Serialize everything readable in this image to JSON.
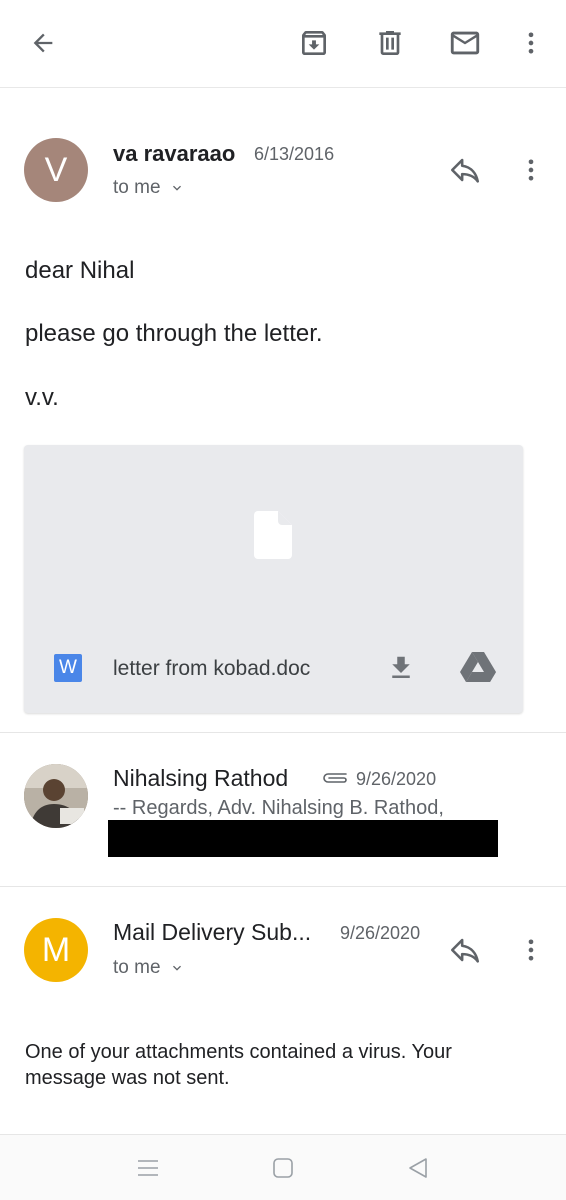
{
  "toolbar": {
    "back_icon": "arrow-back-icon",
    "archive_icon": "archive-icon",
    "delete_icon": "trash-icon",
    "mark_unread_icon": "mail-icon",
    "more_icon": "more-vert-icon"
  },
  "messages": [
    {
      "avatar_letter": "V",
      "avatar_color": "#a5867a",
      "sender": "va ravaraao",
      "date": "6/13/2016",
      "recipient": "to me",
      "body": [
        "dear Nihal",
        "please go through the letter.",
        "v.v."
      ],
      "attachment": {
        "badge": "W",
        "filename": "letter from kobad.doc",
        "file_icon": "file-icon",
        "download_icon": "download-icon",
        "drive_icon": "google-drive-icon"
      }
    },
    {
      "sender": "Nihalsing Rathod",
      "date": "9/26/2020",
      "attachment_icon": "paperclip-icon",
      "snippet": "-- Regards, Adv. Nihalsing B. Rathod,"
    },
    {
      "avatar_letter": "M",
      "avatar_color": "#f4b400",
      "sender": "Mail Delivery Sub...",
      "date": "9/26/2020",
      "recipient": "to me",
      "body": "One of your attachments contained a virus. Your message was not sent."
    }
  ],
  "colors": {
    "card_background": "#e9eaed",
    "divider": "#e6e6e6",
    "word_badge": "#4a86e8"
  }
}
